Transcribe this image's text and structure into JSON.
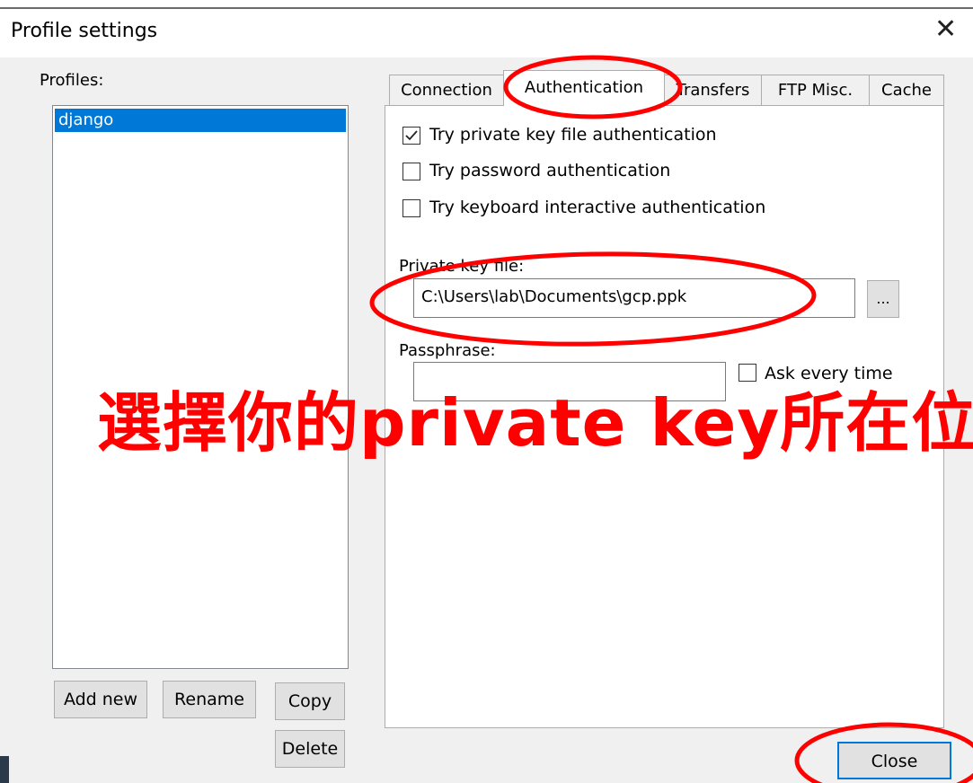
{
  "window": {
    "title": "Profile settings",
    "close_glyph": "✕"
  },
  "profiles": {
    "label": "Profiles:",
    "items": [
      {
        "name": "django",
        "selected": true
      }
    ],
    "buttons": {
      "add_new": "Add new",
      "rename": "Rename",
      "copy": "Copy",
      "delete": "Delete"
    }
  },
  "tabs": [
    {
      "label": "Connection",
      "active": false
    },
    {
      "label": "Authentication",
      "active": true
    },
    {
      "label": "Transfers",
      "active": false
    },
    {
      "label": "FTP Misc.",
      "active": false
    },
    {
      "label": "Cache",
      "active": false
    }
  ],
  "auth": {
    "options": [
      {
        "label": "Try private key file authentication",
        "checked": true
      },
      {
        "label": "Try password authentication",
        "checked": false
      },
      {
        "label": "Try keyboard interactive authentication",
        "checked": false
      }
    ],
    "private_key_label": "Private key file:",
    "private_key_value": "C:\\Users\\lab\\Documents\\gcp.ppk",
    "browse_label": "...",
    "passphrase_label": "Passphrase:",
    "passphrase_value": "",
    "ask_every_time": {
      "label": "Ask every time",
      "checked": false
    }
  },
  "footer": {
    "close_label": "Close"
  },
  "annotation": {
    "text": "選擇你的private key所在位",
    "color": "#ff0000"
  },
  "colors": {
    "accent": "#0078d7",
    "annotation_red": "#ff0000"
  }
}
